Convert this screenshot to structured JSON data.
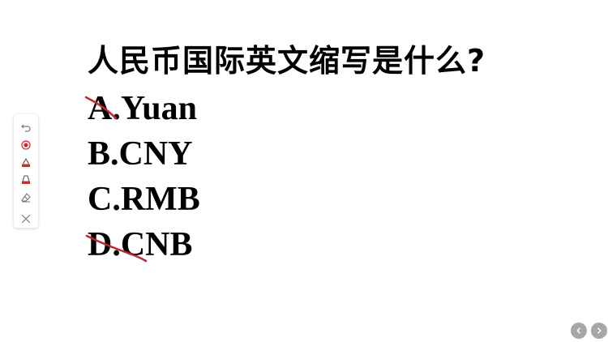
{
  "slide": {
    "question": "人民币国际英文缩写是什么?",
    "options": [
      {
        "text": "A.Yuan"
      },
      {
        "text": "B.CNY"
      },
      {
        "text": "C.RMB"
      },
      {
        "text": "D.CNB"
      }
    ]
  },
  "annotation": {
    "strike_color": "#c0262d"
  },
  "toolbar": {
    "tools": [
      {
        "icon": "undo-icon"
      },
      {
        "icon": "laser-pointer-icon"
      },
      {
        "icon": "pen-icon"
      },
      {
        "icon": "highlighter-icon"
      },
      {
        "icon": "eraser-icon"
      },
      {
        "icon": "close-icon"
      }
    ]
  },
  "navigation": {
    "prev_icon": "chevron-left-icon",
    "next_icon": "chevron-right-icon"
  }
}
